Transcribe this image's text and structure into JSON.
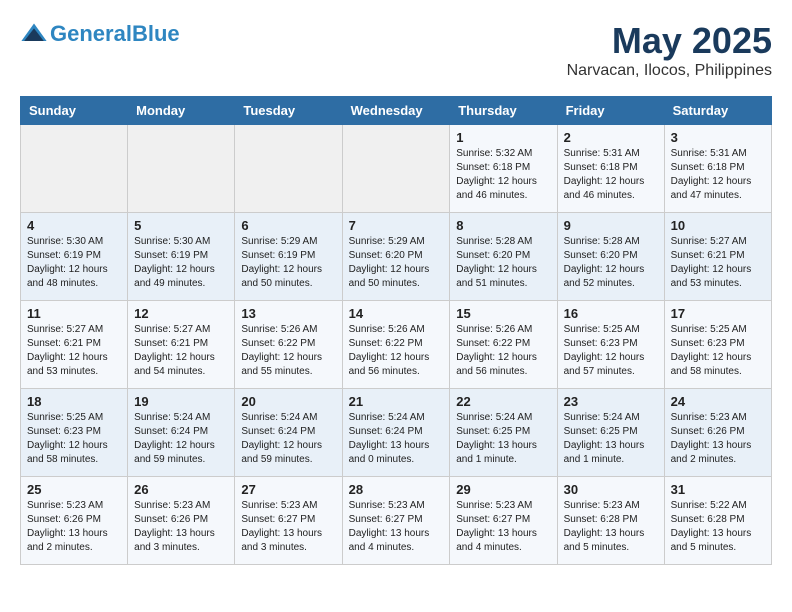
{
  "header": {
    "logo_line1": "General",
    "logo_line2": "Blue",
    "month": "May 2025",
    "location": "Narvacan, Ilocos, Philippines"
  },
  "days_of_week": [
    "Sunday",
    "Monday",
    "Tuesday",
    "Wednesday",
    "Thursday",
    "Friday",
    "Saturday"
  ],
  "weeks": [
    [
      {
        "day": "",
        "content": ""
      },
      {
        "day": "",
        "content": ""
      },
      {
        "day": "",
        "content": ""
      },
      {
        "day": "",
        "content": ""
      },
      {
        "day": "1",
        "content": "Sunrise: 5:32 AM\nSunset: 6:18 PM\nDaylight: 12 hours\nand 46 minutes."
      },
      {
        "day": "2",
        "content": "Sunrise: 5:31 AM\nSunset: 6:18 PM\nDaylight: 12 hours\nand 46 minutes."
      },
      {
        "day": "3",
        "content": "Sunrise: 5:31 AM\nSunset: 6:18 PM\nDaylight: 12 hours\nand 47 minutes."
      }
    ],
    [
      {
        "day": "4",
        "content": "Sunrise: 5:30 AM\nSunset: 6:19 PM\nDaylight: 12 hours\nand 48 minutes."
      },
      {
        "day": "5",
        "content": "Sunrise: 5:30 AM\nSunset: 6:19 PM\nDaylight: 12 hours\nand 49 minutes."
      },
      {
        "day": "6",
        "content": "Sunrise: 5:29 AM\nSunset: 6:19 PM\nDaylight: 12 hours\nand 50 minutes."
      },
      {
        "day": "7",
        "content": "Sunrise: 5:29 AM\nSunset: 6:20 PM\nDaylight: 12 hours\nand 50 minutes."
      },
      {
        "day": "8",
        "content": "Sunrise: 5:28 AM\nSunset: 6:20 PM\nDaylight: 12 hours\nand 51 minutes."
      },
      {
        "day": "9",
        "content": "Sunrise: 5:28 AM\nSunset: 6:20 PM\nDaylight: 12 hours\nand 52 minutes."
      },
      {
        "day": "10",
        "content": "Sunrise: 5:27 AM\nSunset: 6:21 PM\nDaylight: 12 hours\nand 53 minutes."
      }
    ],
    [
      {
        "day": "11",
        "content": "Sunrise: 5:27 AM\nSunset: 6:21 PM\nDaylight: 12 hours\nand 53 minutes."
      },
      {
        "day": "12",
        "content": "Sunrise: 5:27 AM\nSunset: 6:21 PM\nDaylight: 12 hours\nand 54 minutes."
      },
      {
        "day": "13",
        "content": "Sunrise: 5:26 AM\nSunset: 6:22 PM\nDaylight: 12 hours\nand 55 minutes."
      },
      {
        "day": "14",
        "content": "Sunrise: 5:26 AM\nSunset: 6:22 PM\nDaylight: 12 hours\nand 56 minutes."
      },
      {
        "day": "15",
        "content": "Sunrise: 5:26 AM\nSunset: 6:22 PM\nDaylight: 12 hours\nand 56 minutes."
      },
      {
        "day": "16",
        "content": "Sunrise: 5:25 AM\nSunset: 6:23 PM\nDaylight: 12 hours\nand 57 minutes."
      },
      {
        "day": "17",
        "content": "Sunrise: 5:25 AM\nSunset: 6:23 PM\nDaylight: 12 hours\nand 58 minutes."
      }
    ],
    [
      {
        "day": "18",
        "content": "Sunrise: 5:25 AM\nSunset: 6:23 PM\nDaylight: 12 hours\nand 58 minutes."
      },
      {
        "day": "19",
        "content": "Sunrise: 5:24 AM\nSunset: 6:24 PM\nDaylight: 12 hours\nand 59 minutes."
      },
      {
        "day": "20",
        "content": "Sunrise: 5:24 AM\nSunset: 6:24 PM\nDaylight: 12 hours\nand 59 minutes."
      },
      {
        "day": "21",
        "content": "Sunrise: 5:24 AM\nSunset: 6:24 PM\nDaylight: 13 hours\nand 0 minutes."
      },
      {
        "day": "22",
        "content": "Sunrise: 5:24 AM\nSunset: 6:25 PM\nDaylight: 13 hours\nand 1 minute."
      },
      {
        "day": "23",
        "content": "Sunrise: 5:24 AM\nSunset: 6:25 PM\nDaylight: 13 hours\nand 1 minute."
      },
      {
        "day": "24",
        "content": "Sunrise: 5:23 AM\nSunset: 6:26 PM\nDaylight: 13 hours\nand 2 minutes."
      }
    ],
    [
      {
        "day": "25",
        "content": "Sunrise: 5:23 AM\nSunset: 6:26 PM\nDaylight: 13 hours\nand 2 minutes."
      },
      {
        "day": "26",
        "content": "Sunrise: 5:23 AM\nSunset: 6:26 PM\nDaylight: 13 hours\nand 3 minutes."
      },
      {
        "day": "27",
        "content": "Sunrise: 5:23 AM\nSunset: 6:27 PM\nDaylight: 13 hours\nand 3 minutes."
      },
      {
        "day": "28",
        "content": "Sunrise: 5:23 AM\nSunset: 6:27 PM\nDaylight: 13 hours\nand 4 minutes."
      },
      {
        "day": "29",
        "content": "Sunrise: 5:23 AM\nSunset: 6:27 PM\nDaylight: 13 hours\nand 4 minutes."
      },
      {
        "day": "30",
        "content": "Sunrise: 5:23 AM\nSunset: 6:28 PM\nDaylight: 13 hours\nand 5 minutes."
      },
      {
        "day": "31",
        "content": "Sunrise: 5:22 AM\nSunset: 6:28 PM\nDaylight: 13 hours\nand 5 minutes."
      }
    ]
  ]
}
